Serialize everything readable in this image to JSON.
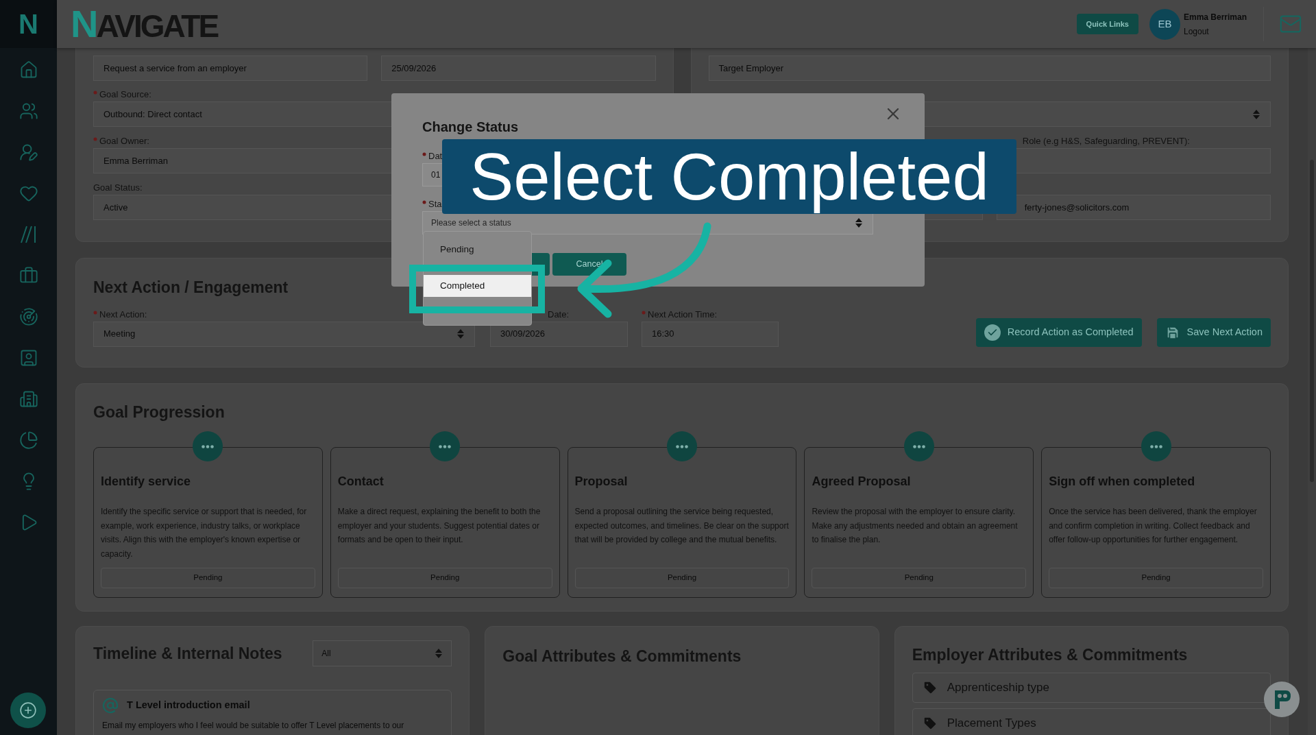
{
  "sidebar": {
    "logo": "N"
  },
  "header": {
    "logo": "NAVIGATE",
    "quick_links": "Quick Links",
    "user": {
      "initials": "EB",
      "name": "Emma Berriman",
      "logout": "Logout"
    }
  },
  "goal_details": {
    "rows": [
      [
        {
          "kind": "text",
          "value": "Request a service from an employer"
        },
        {
          "kind": "text",
          "value": "25/09/2026"
        }
      ],
      [
        {
          "kind": "text",
          "label": "Goal Source:",
          "required": true,
          "value": "Outbound: Direct contact"
        }
      ],
      [
        {
          "kind": "text",
          "label": "Goal Owner:",
          "required": true,
          "value": "Emma Berriman"
        }
      ],
      [
        {
          "kind": "text",
          "label": "Goal Status:",
          "required": false,
          "value": "Active"
        }
      ]
    ]
  },
  "organisation": {
    "rows": [
      [
        {
          "kind": "text",
          "value": "Target Employer"
        }
      ],
      [
        {
          "kind": "select"
        }
      ],
      [
        "",
        {
          "kind": "text",
          "label": "Role (e.g H&S, Safeguarding, PREVENT):"
        }
      ],
      [
        {
          "kind": "text"
        },
        {
          "kind": "text",
          "value": "ferty-jones@solicitors.com"
        }
      ]
    ]
  },
  "next_action": {
    "title": "Next Action / Engagement",
    "fields": [
      {
        "kind": "select",
        "label": "Next Action:",
        "required": true,
        "value": "Meeting"
      },
      {
        "kind": "text",
        "label": "Date:",
        "required": false,
        "value": "30/09/2026"
      },
      {
        "kind": "text",
        "label": "Next Action Time:",
        "required": true,
        "value": "16:30"
      }
    ],
    "buttons": [
      {
        "kind": "check",
        "label": "Record Action as Completed"
      },
      {
        "kind": "save",
        "label": "Save Next Action"
      }
    ]
  },
  "goal_progression": {
    "title": "Goal Progression",
    "stages": [
      {
        "title": "Identify service",
        "description": "Identify the specific service or support that is needed, for example, work experience, industry talks, or workplace visits. Align this with the employer's known expertise or capacity.",
        "status": "Pending"
      },
      {
        "title": "Contact",
        "description": "Make a direct request, explaining the benefit to both the employer and your students. Suggest potential dates or formats and be open to their input.",
        "status": "Pending"
      },
      {
        "title": "Proposal",
        "description": "Send a proposal outlining the service being requested, expected outcomes, and timelines. Be clear on the support that will be provided by college and the mutual benefits.",
        "status": "Pending"
      },
      {
        "title": "Agreed Proposal",
        "description": "Review the proposal with the employer to ensure clarity. Make any adjustments needed and obtain an agreement to finalise the plan.",
        "status": "Pending"
      },
      {
        "title": "Sign off when completed",
        "description": "Once the service has been delivered, thank the employer and confirm completion in writing. Collect feedback and offer follow-up opportunities for further engagement.",
        "status": "Pending"
      }
    ]
  },
  "timeline": {
    "title": "Timeline & Internal Notes",
    "filter": "All",
    "notes": [
      {
        "title": "T Level introduction email",
        "text": "Email my employers who I feel would be suitable to offer T Level placements to our"
      }
    ]
  },
  "goal_attributes": {
    "title": "Goal Attributes & Commitments"
  },
  "employer_attributes": {
    "title": "Employer Attributes & Commitments",
    "items": [
      "Apprenticeship type",
      "Placement Types"
    ]
  },
  "modal": {
    "title": "Change Status",
    "fields": [
      {
        "label": "Dat",
        "required": true,
        "value": "01"
      },
      {
        "label": "Sta",
        "required": true,
        "placeholder": "Please select a status"
      }
    ],
    "buttons": [
      {
        "kind": "primary"
      },
      {
        "kind": "secondary",
        "label": "Cancel"
      }
    ]
  },
  "dropdown": {
    "options": [
      {
        "label": "Pending",
        "selected": false
      },
      {
        "label": "Completed",
        "selected": true
      }
    ]
  },
  "callout": {
    "text": "Select Completed"
  }
}
